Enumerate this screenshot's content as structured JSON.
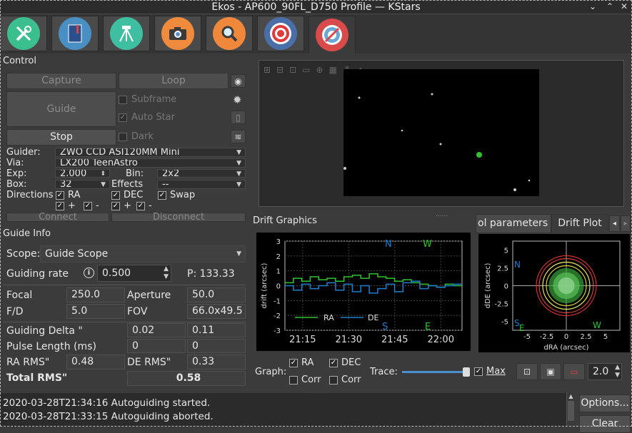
{
  "window": {
    "title": "Ekos - AP600_90FL_D750 Profile — KStars",
    "minimize": "⌄",
    "maximize": "⌃",
    "close": "✕"
  },
  "tabs": [
    {
      "name": "setup",
      "icon": "wrench-icon",
      "color": "#3bbf8f"
    },
    {
      "name": "scheduler",
      "icon": "notebook-icon",
      "color": "#4a8fc4"
    },
    {
      "name": "mount",
      "icon": "tripod-icon",
      "color": "#3fbfa2"
    },
    {
      "name": "capture",
      "icon": "camera-icon",
      "color": "#f08a3c"
    },
    {
      "name": "align",
      "icon": "magnifier-icon",
      "color": "#f0883c"
    },
    {
      "name": "focus",
      "icon": "target-icon",
      "color": "#4a6fa8"
    },
    {
      "name": "guide",
      "icon": "guide-target-icon",
      "color": "#d94a4a"
    }
  ],
  "control": {
    "title": "Control",
    "capture": "Capture",
    "loop": "Loop",
    "guide": "Guide",
    "stop": "Stop",
    "subframe": "Subframe",
    "auto_star": "Auto Star",
    "dark": "Dark",
    "guider_label": "Guider:",
    "guider_value": "ZWO CCD ASI120MM Mini",
    "via_label": "Via:",
    "via_value": "LX200 TeenAstro",
    "exp_label": "Exp:",
    "exp_value": "2.000",
    "bin_label": "Bin:",
    "bin_value": "2x2",
    "box_label": "Box:",
    "box_value": "32",
    "effects_label": "Effects",
    "effects_value": "--",
    "directions_label": "Directions",
    "ra": "RA",
    "dec": "DEC",
    "swap": "Swap",
    "plus": "+",
    "minus": "-",
    "connect": "Connect",
    "disconnect": "Disconnect"
  },
  "guide_info": {
    "title": "Guide Info",
    "scope_label": "Scope:",
    "scope_value": "Guide Scope",
    "rate_label": "Guiding rate",
    "rate_value": "0.500",
    "p_label": "P: 133.33",
    "focal_label": "Focal",
    "focal_value": "250.0",
    "aperture_label": "Aperture",
    "aperture_value": "50.0",
    "fd_label": "F/D",
    "fd_value": "5.0",
    "fov_label": "FOV",
    "fov_value": "66.0x49.5",
    "delta_label": "Guiding Delta \"",
    "delta_ra": "0.02",
    "delta_de": "0.11",
    "pulse_label": "Pulse Length (ms)",
    "pulse_ra": "0",
    "pulse_de": "0",
    "ra_rms_label": "RA RMS\"",
    "ra_rms": "0.48",
    "de_rms_label": "DE RMS\"",
    "de_rms": "0.33",
    "total_label": "Total RMS\"",
    "total": "0.58"
  },
  "drift": {
    "title": "Drift Graphics",
    "ylabel": "drift (arcsec)",
    "yticks": [
      "3",
      "2",
      "1",
      "0",
      "-1",
      "-2",
      "-3"
    ],
    "xticks": [
      "21:15",
      "21:30",
      "21:45",
      "22:00"
    ],
    "n": "N",
    "w": "W",
    "s": "S",
    "e": "E",
    "legend_ra": "RA",
    "legend_de": "DE",
    "ra_color": "#2fc42f",
    "de_color": "#1e7fd0",
    "graph_label": "Graph:",
    "graph_ra": "RA",
    "graph_dec": "DEC",
    "corr": "Corr",
    "trace_label": "Trace:",
    "max_label": "Max",
    "zoom_value": "2.0"
  },
  "plot_tabs": {
    "tab1": "ol parameters",
    "tab2": "Drift Plot"
  },
  "drift_plot": {
    "xlabel": "dRA (arcsec)",
    "ylabel": "dDE (arcsec)",
    "xticks": [
      "-5",
      "-2.5",
      "0",
      "2.5",
      "5"
    ],
    "yticks": [
      "5",
      "2.5",
      "0",
      "-2.5",
      "-5"
    ],
    "n": "N",
    "w": "W",
    "s": "S",
    "e": "E"
  },
  "log": {
    "lines": [
      "2020-03-28T21:34:16 Autoguiding started.",
      "2020-03-28T21:33:15 Autoguiding aborted."
    ],
    "options": "Options...",
    "clear": "Clear"
  },
  "chart_data": {
    "type": "line",
    "ylabel": "drift (arcsec)",
    "ylim": [
      -3,
      3
    ],
    "xticks": [
      "21:15",
      "21:30",
      "21:45",
      "22:00"
    ],
    "series": [
      {
        "name": "RA",
        "values": [
          0.2,
          0.5,
          0.3,
          0.6,
          0.4,
          0.5,
          0.3,
          0.6,
          0.7,
          0.5,
          0.8,
          0.6,
          0.5,
          0.3,
          0.4,
          0.2,
          0.1,
          0.0,
          -0.1,
          0.1,
          0.0
        ]
      },
      {
        "name": "DE",
        "values": [
          0.0,
          -0.3,
          0.1,
          -0.2,
          0.0,
          0.2,
          -0.3,
          0.1,
          -0.4,
          0.0,
          -0.5,
          -0.2,
          0.1,
          -0.4,
          0.2,
          0.3,
          -0.2,
          0.0,
          -0.1,
          0.0,
          0.1
        ]
      }
    ]
  }
}
